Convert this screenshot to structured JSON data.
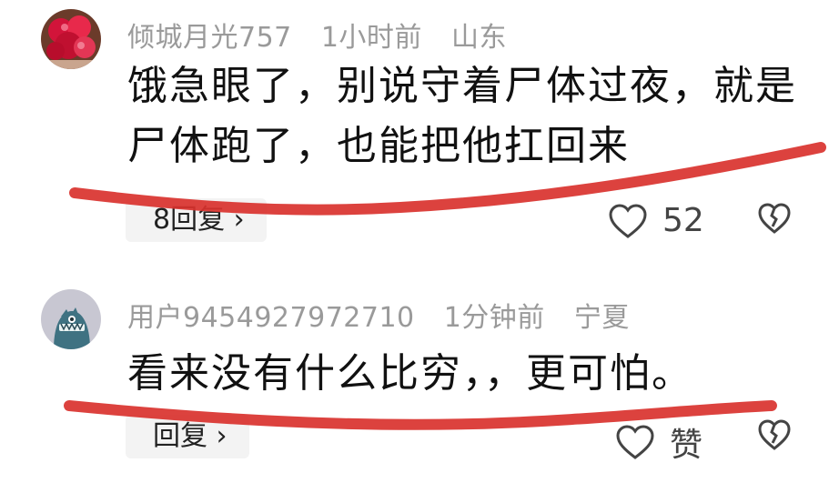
{
  "comments": [
    {
      "username": "倾城月光757",
      "time": "1小时前",
      "location": "山东",
      "text": "饿急眼了，别说守着尸体过夜，就是尸体跑了，也能把他扛回来",
      "reply_label": "8回复 ›",
      "like_count": "52",
      "avatar_icon": "red-flower-avatar"
    },
    {
      "username": "用户9454927972710",
      "time": "1分钟前",
      "location": "宁夏",
      "text": "看来没有什么比穷，，更可怕。",
      "reply_label": "回复 ›",
      "like_count": "赞",
      "avatar_icon": "cartoon-creature-avatar"
    }
  ],
  "colors": {
    "underline": "#d9322e",
    "meta_text": "#9a9a9a",
    "reply_bg": "#f3f3f3"
  }
}
